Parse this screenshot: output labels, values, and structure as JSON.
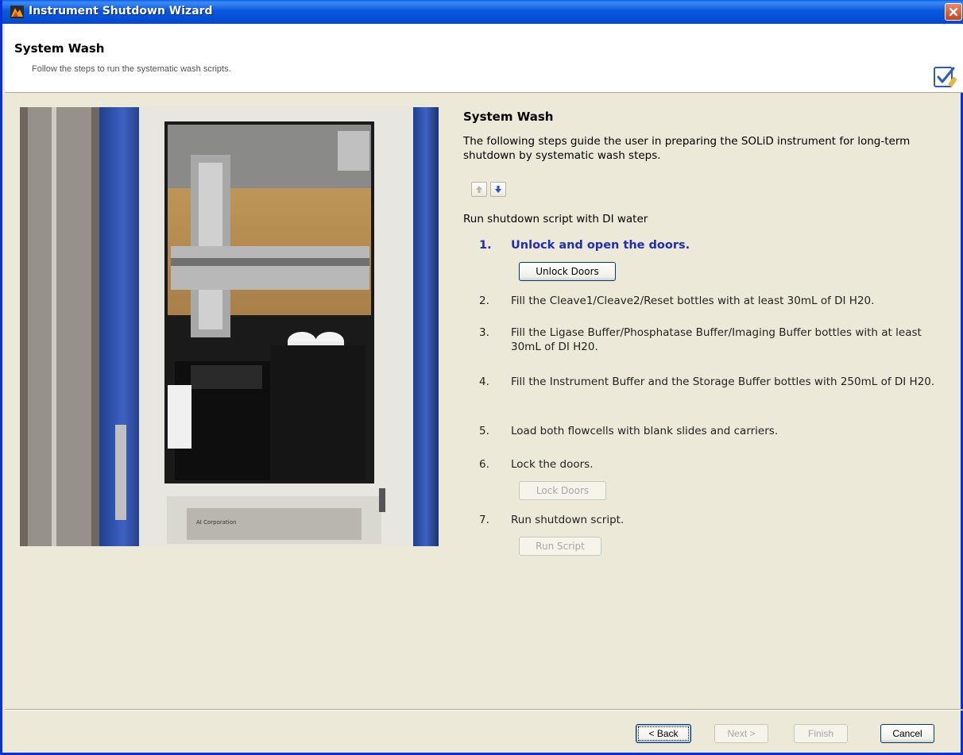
{
  "window": {
    "title": "Instrument Shutdown Wizard"
  },
  "header": {
    "title": "System Wash",
    "subtitle": "Follow the steps to run the systematic wash scripts."
  },
  "content": {
    "title": "System Wash",
    "description": "The following steps guide the user in preparing the SOLiD instrument for long-term shutdown by systematic wash steps.",
    "run_label": "Run shutdown script with DI water",
    "steps": [
      {
        "num": "1.",
        "text": "Unlock and open the doors.",
        "button": "Unlock Doors",
        "button_enabled": true,
        "active": true
      },
      {
        "num": "2.",
        "text": "Fill the Cleave1/Cleave2/Reset bottles with at least 30mL of DI H20."
      },
      {
        "num": "3.",
        "text": "Fill the Ligase Buffer/Phosphatase Buffer/Imaging Buffer bottles with at least 30mL of DI H20."
      },
      {
        "num": "4.",
        "text": "Fill the Instrument Buffer and the Storage Buffer bottles with 250mL of DI H20."
      },
      {
        "num": "5.",
        "text": "Load both flowcells with blank slides and carriers."
      },
      {
        "num": "6.",
        "text": "Lock the doors.",
        "button": "Lock Doors",
        "button_enabled": false
      },
      {
        "num": "7.",
        "text": "Run shutdown script.",
        "button": "Run Script",
        "button_enabled": false
      }
    ]
  },
  "photo": {
    "panel_labels": [
      "AI Corporation"
    ]
  },
  "footer": {
    "back": "< Back",
    "next": "Next >",
    "finish": "Finish",
    "cancel": "Cancel"
  },
  "icons": {
    "title_icon": "app-logo-icon",
    "close": "close-icon",
    "header": "checklist-icon",
    "up": "arrow-up-icon",
    "down": "arrow-down-icon"
  },
  "colors": {
    "titlebar": "#0A58DC",
    "active_step": "#1C2DB8",
    "background": "#ECE9D8"
  }
}
